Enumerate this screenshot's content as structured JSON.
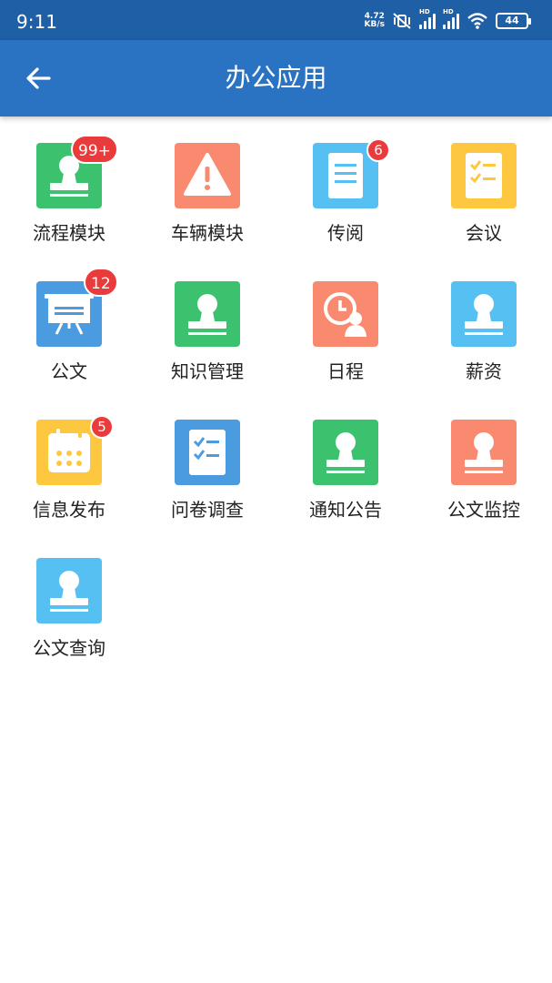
{
  "status": {
    "time": "9:11",
    "net_speed_value": "4.72",
    "net_speed_unit": "KB/s",
    "signal_1_label": "HD",
    "signal_2_label": "HD",
    "battery": "44"
  },
  "header": {
    "title": "办公应用",
    "back_icon": "arrow-left-icon"
  },
  "colors": {
    "status_bar": "#1f5fa6",
    "app_bar": "#2a73c2",
    "green": "#3cc26f",
    "salmon": "#f98a6f",
    "sky": "#56c0f2",
    "amber": "#fdc740",
    "blue": "#4a9be0",
    "badge": "#e93b3b"
  },
  "apps": [
    {
      "label": "流程模块",
      "icon": "stamp-icon",
      "color": "#3cc26f",
      "badge": "99+"
    },
    {
      "label": "车辆模块",
      "icon": "warning-icon",
      "color": "#f98a6f",
      "badge": ""
    },
    {
      "label": "传阅",
      "icon": "document-icon",
      "color": "#56c0f2",
      "badge": "6"
    },
    {
      "label": "会议",
      "icon": "checklist-icon",
      "color": "#fdc740",
      "badge": ""
    },
    {
      "label": "公文",
      "icon": "presentation-board-icon",
      "color": "#4a9be0",
      "badge": "12"
    },
    {
      "label": "知识管理",
      "icon": "stamp-icon",
      "color": "#3cc26f",
      "badge": ""
    },
    {
      "label": "日程",
      "icon": "clock-user-icon",
      "color": "#f98a6f",
      "badge": ""
    },
    {
      "label": "薪资",
      "icon": "stamp-icon",
      "color": "#56c0f2",
      "badge": ""
    },
    {
      "label": "信息发布",
      "icon": "calendar-icon",
      "color": "#fdc740",
      "badge": "5"
    },
    {
      "label": "问卷调查",
      "icon": "checklist-icon",
      "color": "#4a9be0",
      "badge": ""
    },
    {
      "label": "通知公告",
      "icon": "stamp-icon",
      "color": "#3cc26f",
      "badge": ""
    },
    {
      "label": "公文监控",
      "icon": "stamp-icon",
      "color": "#f98a6f",
      "badge": ""
    },
    {
      "label": "公文查询",
      "icon": "stamp-icon",
      "color": "#56c0f2",
      "badge": ""
    }
  ]
}
